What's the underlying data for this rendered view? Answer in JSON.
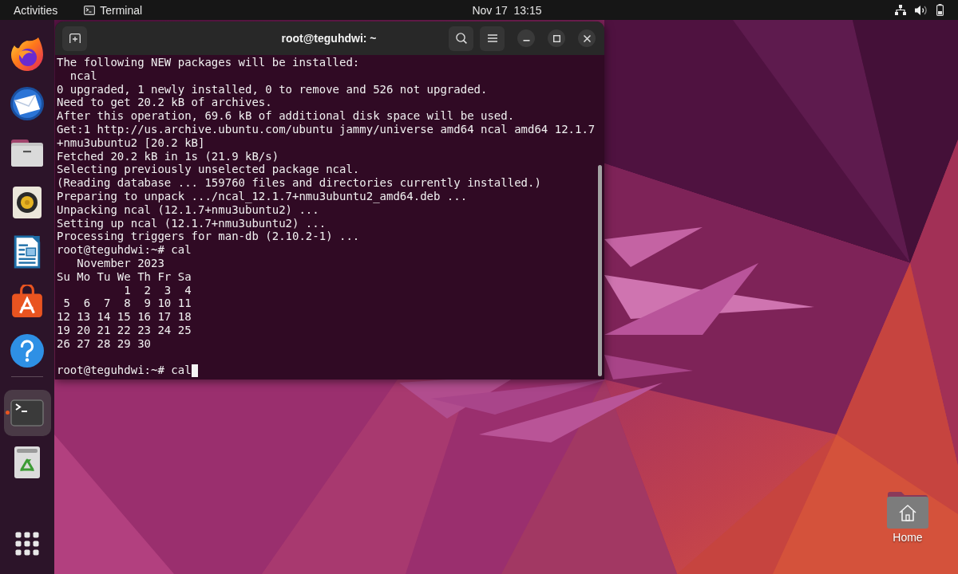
{
  "top_bar": {
    "activities": "Activities",
    "app_menu": "Terminal",
    "clock": "Nov 17  13:15"
  },
  "dock": {
    "favorites": [
      {
        "kind": "browser",
        "running": false,
        "focused": false
      },
      {
        "kind": "mail",
        "running": false,
        "focused": false
      },
      {
        "kind": "files",
        "running": false,
        "focused": false
      },
      {
        "kind": "music",
        "running": false,
        "focused": false
      },
      {
        "kind": "writer",
        "running": false,
        "focused": false
      },
      {
        "kind": "store",
        "running": false,
        "focused": false
      },
      {
        "kind": "help",
        "running": false,
        "focused": false
      }
    ],
    "others": [
      {
        "kind": "terminal",
        "running": true,
        "focused": true
      },
      {
        "kind": "trash",
        "running": false,
        "focused": false
      }
    ]
  },
  "terminal_window": {
    "title": "root@teguhdwi: ~",
    "lines": [
      {
        "kind": "output",
        "text": "The following NEW packages will be installed:"
      },
      {
        "kind": "output",
        "text": "  ncal"
      },
      {
        "kind": "output",
        "text": "0 upgraded, 1 newly installed, 0 to remove and 526 not upgraded."
      },
      {
        "kind": "output",
        "text": "Need to get 20.2 kB of archives."
      },
      {
        "kind": "output",
        "text": "After this operation, 69.6 kB of additional disk space will be used."
      },
      {
        "kind": "output",
        "text": "Get:1 http://us.archive.ubuntu.com/ubuntu jammy/universe amd64 ncal amd64 12.1.7"
      },
      {
        "kind": "output",
        "text": "+nmu3ubuntu2 [20.2 kB]"
      },
      {
        "kind": "output",
        "text": "Fetched 20.2 kB in 1s (21.9 kB/s)"
      },
      {
        "kind": "output",
        "text": "Selecting previously unselected package ncal."
      },
      {
        "kind": "output",
        "text": "(Reading database ... 159760 files and directories currently installed.)"
      },
      {
        "kind": "output",
        "text": "Preparing to unpack .../ncal_12.1.7+nmu3ubuntu2_amd64.deb ..."
      },
      {
        "kind": "output",
        "text": "Unpacking ncal (12.1.7+nmu3ubuntu2) ..."
      },
      {
        "kind": "output",
        "text": "Setting up ncal (12.1.7+nmu3ubuntu2) ..."
      },
      {
        "kind": "output",
        "text": "Processing triggers for man-db (2.10.2-1) ..."
      },
      {
        "kind": "prompt",
        "text": "root@teguhdwi:~# cal",
        "cursor": false
      },
      {
        "kind": "output",
        "text": "   November 2023"
      },
      {
        "kind": "output",
        "text": "Su Mo Tu We Th Fr Sa"
      },
      {
        "kind": "output",
        "text": "          1  2  3  4"
      },
      {
        "kind": "output",
        "text": " 5  6  7  8  9 10 11"
      },
      {
        "kind": "output",
        "text": "12 13 14 15 16 17 18"
      },
      {
        "kind": "output",
        "text": "19 20 21 22 23 24 25"
      },
      {
        "kind": "output",
        "text": "26 27 28 29 30"
      },
      {
        "kind": "blank"
      },
      {
        "kind": "prompt",
        "text": "root@teguhdwi:~# cal",
        "cursor": true
      }
    ]
  },
  "desktop": {
    "icons": [
      {
        "kind": "home",
        "label": "Home"
      }
    ]
  }
}
